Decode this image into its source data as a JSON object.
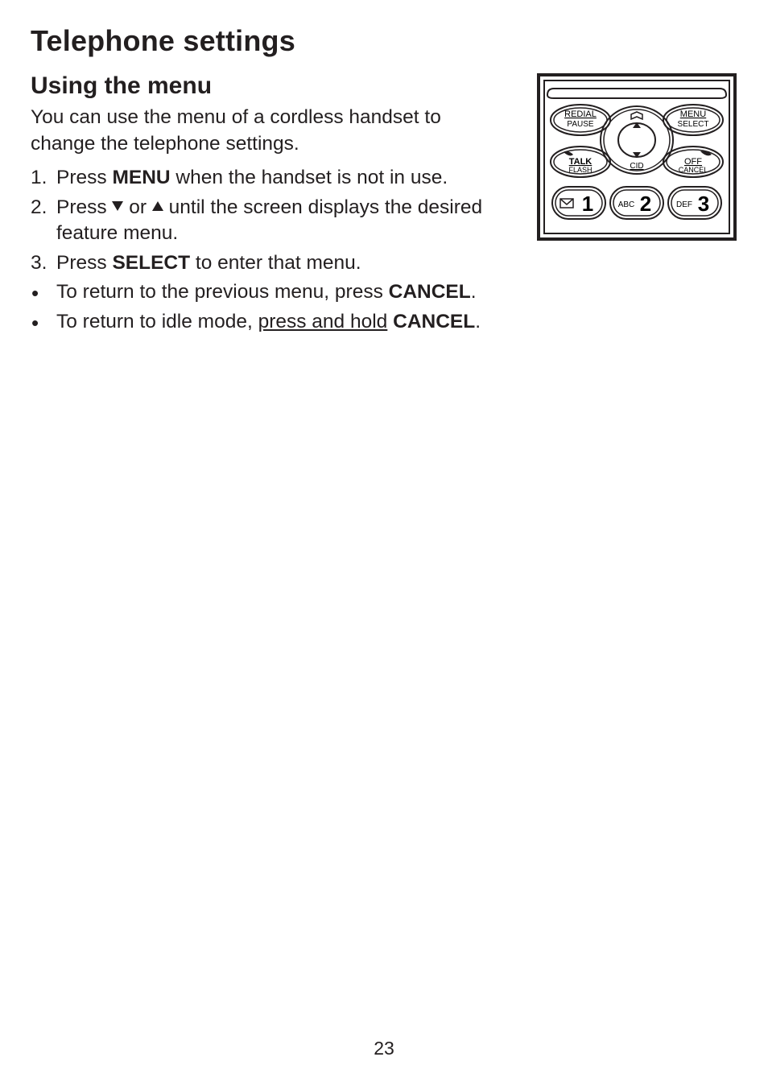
{
  "title": "Telephone settings",
  "subtitle": "Using the menu",
  "intro": "You can use the menu of a cordless handset to change the telephone settings.",
  "steps": [
    {
      "num": "1.",
      "pre": "Press ",
      "bold": "MENU",
      "post": " when the handset is not in use."
    },
    {
      "num": "2.",
      "pre": "Press ",
      "arrows": true,
      "mid": " or ",
      "post2": " until the screen displays the desired feature menu."
    },
    {
      "num": "3.",
      "pre": "Press ",
      "bold": "SELECT",
      "post": " to enter that menu."
    }
  ],
  "bullets": [
    {
      "pre": "To return to the previous menu, press ",
      "bold": "CANCEL",
      "post": "."
    },
    {
      "pre": "To return to idle mode, ",
      "u": "press and hold",
      "mid": " ",
      "bold": "CANCEL",
      "post": "."
    }
  ],
  "page_number": "23",
  "handset": {
    "redial_top": "REDIAL",
    "redial_bot": "PAUSE",
    "menu_top": "MENU",
    "menu_bot": "SELECT",
    "talk_top": "TALK",
    "talk_bot": "FLASH",
    "off_top": "OFF",
    "off_bot": "CANCEL",
    "cid": "CID",
    "k1": "1",
    "k1_sub": "",
    "k2": "2",
    "k2_sub": "ABC",
    "k3": "3",
    "k3_sub": "DEF"
  }
}
